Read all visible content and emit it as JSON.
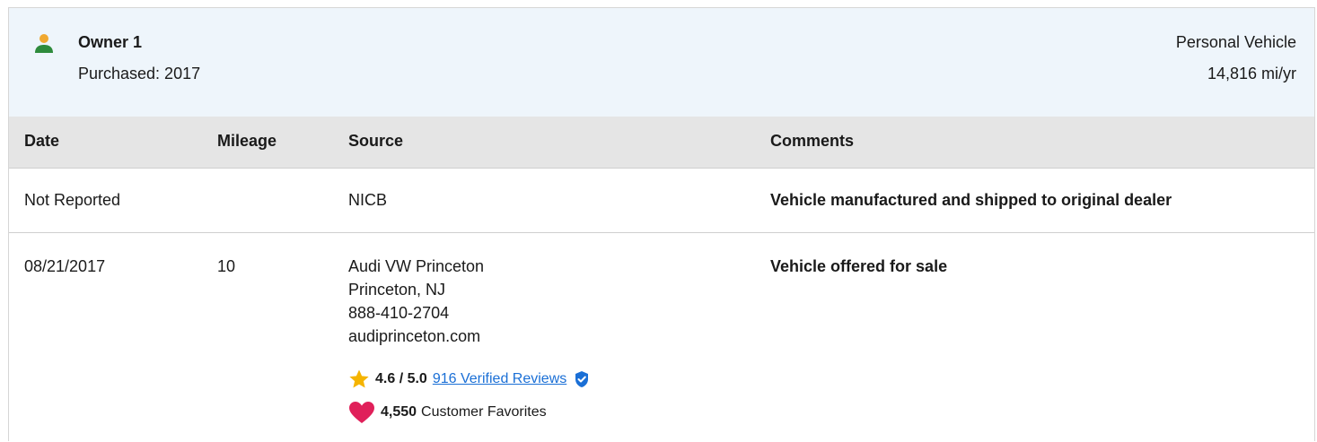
{
  "owner": {
    "title": "Owner 1",
    "purchased": "Purchased: 2017",
    "usage_type": "Personal Vehicle",
    "miles_per_year": "14,816 mi/yr"
  },
  "table": {
    "headers": {
      "date": "Date",
      "mileage": "Mileage",
      "source": "Source",
      "comments": "Comments"
    },
    "rows": [
      {
        "date": "Not Reported",
        "mileage": "",
        "source": [
          "NICB"
        ],
        "comment": "Vehicle manufactured and shipped to original dealer"
      },
      {
        "date": "08/21/2017",
        "mileage": "10",
        "source": [
          "Audi VW Princeton",
          "Princeton, NJ",
          "888-410-2704",
          "audiprinceton.com"
        ],
        "comment": "Vehicle offered for sale",
        "rating": {
          "score": "4.6 / 5.0",
          "reviews_link": "916 Verified Reviews"
        },
        "favorites": {
          "count": "4,550",
          "label": "Customer Favorites"
        }
      }
    ]
  },
  "colors": {
    "header_bg": "#eef5fb",
    "table_header_bg": "#e5e5e5",
    "person_icon": "#2e8b3c",
    "star": "#f5b400",
    "heart": "#e0205a",
    "link": "#1a6fd6",
    "shield": "#1a6fd6"
  },
  "icons": {
    "owner": "person-icon",
    "rating": "star-icon",
    "verified": "verified-shield-icon",
    "favorites": "heart-icon"
  }
}
